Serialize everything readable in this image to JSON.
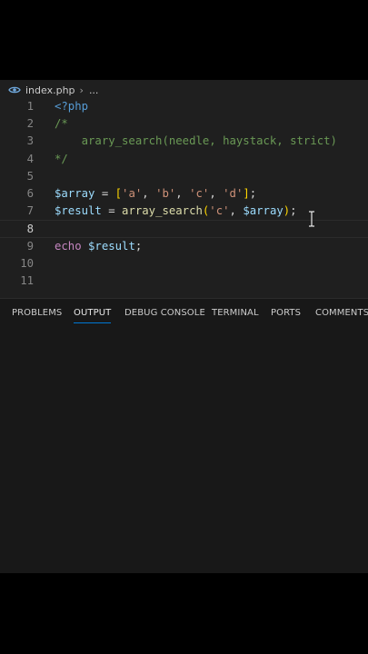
{
  "breadcrumb": {
    "file": "index.php",
    "ellipsis": "..."
  },
  "editor": {
    "lines": [
      {
        "n": "1",
        "tokens": [
          {
            "t": "<?php",
            "c": "tag"
          }
        ]
      },
      {
        "n": "2",
        "tokens": [
          {
            "t": "/*",
            "c": "com"
          }
        ]
      },
      {
        "n": "3",
        "tokens": [
          {
            "t": "    arary_search(needle, haystack, strict)",
            "c": "com"
          }
        ]
      },
      {
        "n": "4",
        "tokens": [
          {
            "t": "*/",
            "c": "com"
          }
        ]
      },
      {
        "n": "5",
        "tokens": []
      },
      {
        "n": "6",
        "tokens": [
          {
            "t": "$array",
            "c": "var"
          },
          {
            "t": " = ",
            "c": "op"
          },
          {
            "t": "[",
            "c": "br"
          },
          {
            "t": "'a'",
            "c": "str"
          },
          {
            "t": ", ",
            "c": "op"
          },
          {
            "t": "'b'",
            "c": "str"
          },
          {
            "t": ", ",
            "c": "op"
          },
          {
            "t": "'c'",
            "c": "str"
          },
          {
            "t": ", ",
            "c": "op"
          },
          {
            "t": "'d'",
            "c": "str"
          },
          {
            "t": "]",
            "c": "br"
          },
          {
            "t": ";",
            "c": "op"
          }
        ]
      },
      {
        "n": "7",
        "tokens": [
          {
            "t": "$result",
            "c": "var"
          },
          {
            "t": " = ",
            "c": "op"
          },
          {
            "t": "array_search",
            "c": "fn"
          },
          {
            "t": "(",
            "c": "br"
          },
          {
            "t": "'c'",
            "c": "str"
          },
          {
            "t": ", ",
            "c": "op"
          },
          {
            "t": "$array",
            "c": "var"
          },
          {
            "t": ")",
            "c": "br"
          },
          {
            "t": ";",
            "c": "op"
          }
        ]
      },
      {
        "n": "8",
        "tokens": [],
        "current": true
      },
      {
        "n": "9",
        "tokens": [
          {
            "t": "echo",
            "c": "kw"
          },
          {
            "t": " ",
            "c": "op"
          },
          {
            "t": "$result",
            "c": "var"
          },
          {
            "t": ";",
            "c": "op"
          }
        ]
      },
      {
        "n": "10",
        "tokens": []
      },
      {
        "n": "11",
        "tokens": []
      }
    ]
  },
  "panel": {
    "tabs": [
      {
        "label": "PROBLEMS",
        "active": false
      },
      {
        "label": "OUTPUT",
        "active": true
      },
      {
        "label": "DEBUG CONSOLE",
        "active": false
      },
      {
        "label": "TERMINAL",
        "active": false
      },
      {
        "label": "PORTS",
        "active": false
      },
      {
        "label": "COMMENTS",
        "active": false
      }
    ]
  },
  "icons": {
    "breadcrumb": "eye-icon",
    "separator": "chevron-right-icon",
    "cursor": "text-cursor-icon"
  },
  "colors": {
    "editor_bg": "#1f1f1f",
    "panel_bg": "#181818",
    "tag": "#569cd6",
    "comment": "#6a9955",
    "variable": "#9cdcfe",
    "function": "#dcdcaa",
    "string": "#ce9178",
    "keyword": "#c586c0",
    "bracket": "#ffd700",
    "active_tab_underline": "#0078d4"
  }
}
